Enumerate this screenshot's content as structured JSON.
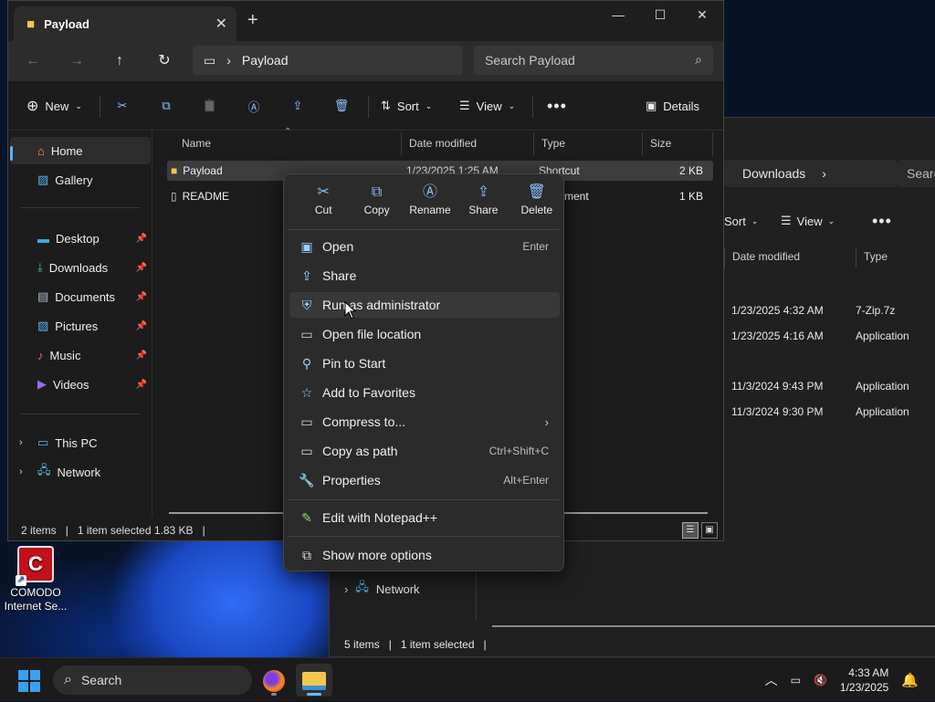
{
  "desktop": {
    "icon_label_line1": "COMODO",
    "icon_label_line2": "Internet Se..."
  },
  "back_window": {
    "address": "Downloads",
    "search_placeholder": "Searc",
    "toolbar": {
      "sort": "Sort",
      "view": "View"
    },
    "columns": [
      "Date modified",
      "Type"
    ],
    "rows": [
      {
        "date": "1/23/2025 4:32 AM",
        "type": "7-Zip.7z"
      },
      {
        "date": "1/23/2025 4:16 AM",
        "type": "Application"
      },
      {
        "date": "11/3/2024 9:43 PM",
        "type": "Application"
      },
      {
        "date": "11/3/2024 9:30 PM",
        "type": "Application"
      }
    ],
    "sidebar_network": "Network",
    "status": {
      "count": "5 items",
      "selected": "1 item selected"
    }
  },
  "front_window": {
    "tab_title": "Payload",
    "address": "Payload",
    "search_placeholder": "Search Payload",
    "toolbar": {
      "new": "New",
      "sort": "Sort",
      "view": "View",
      "details": "Details"
    },
    "sidebar": {
      "home": "Home",
      "gallery": "Gallery",
      "pinned": [
        "Desktop",
        "Downloads",
        "Documents",
        "Pictures",
        "Music",
        "Videos"
      ],
      "this_pc": "This PC",
      "network": "Network"
    },
    "columns": {
      "name": "Name",
      "date": "Date modified",
      "type": "Type",
      "size": "Size"
    },
    "files": [
      {
        "name": "Payload",
        "date": "1/23/2025 1:25 AM",
        "type": "Shortcut",
        "size": "2 KB"
      },
      {
        "name": "README",
        "date": "",
        "type": "Document",
        "size": "1 KB"
      }
    ],
    "status": {
      "count": "2 items",
      "selected": "1 item selected  1.83 KB"
    }
  },
  "context_menu": {
    "quick_actions": [
      "Cut",
      "Copy",
      "Rename",
      "Share",
      "Delete"
    ],
    "items": [
      {
        "label": "Open",
        "shortcut": "Enter"
      },
      {
        "label": "Share",
        "shortcut": ""
      },
      {
        "label": "Run as administrator",
        "shortcut": ""
      },
      {
        "label": "Open file location",
        "shortcut": ""
      },
      {
        "label": "Pin to Start",
        "shortcut": ""
      },
      {
        "label": "Add to Favorites",
        "shortcut": ""
      },
      {
        "label": "Compress to...",
        "shortcut": ""
      },
      {
        "label": "Copy as path",
        "shortcut": "Ctrl+Shift+C"
      },
      {
        "label": "Properties",
        "shortcut": "Alt+Enter"
      }
    ],
    "extra_items": [
      "Edit with Notepad++",
      "Show more options"
    ]
  },
  "taskbar": {
    "search_label": "Search",
    "time": "4:33 AM",
    "date": "1/23/2025"
  },
  "colors": {
    "accent": "#5fb2f2",
    "folder": "#f3c74e",
    "menu_bg": "#2b2b2b"
  }
}
